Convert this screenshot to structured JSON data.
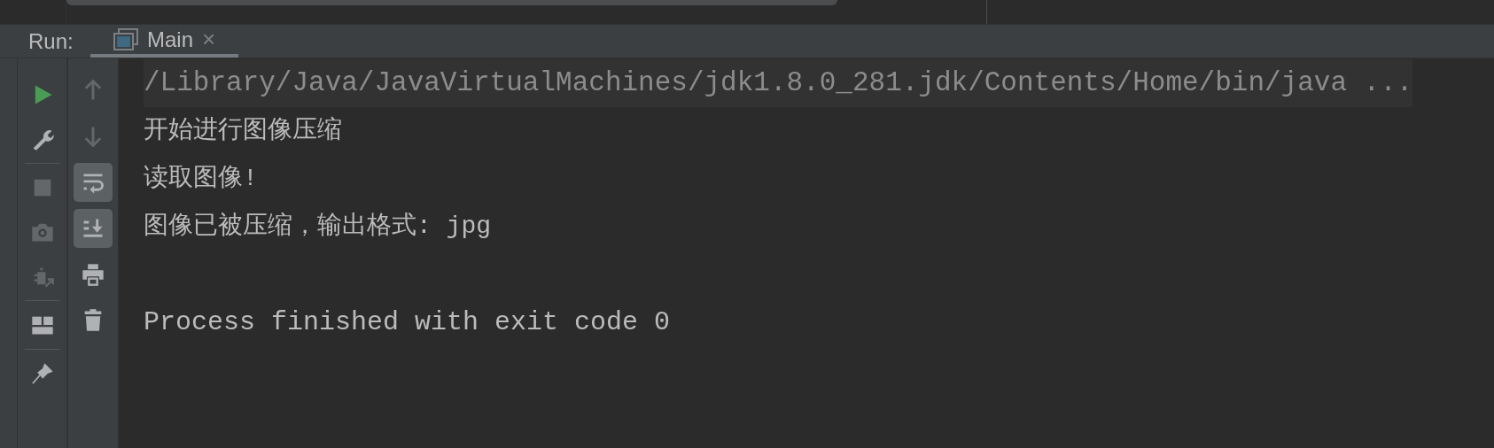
{
  "run_panel": {
    "label": "Run:",
    "tabs": [
      {
        "label": "Main",
        "selected": true,
        "close": "×"
      }
    ]
  },
  "left_toolbar": [
    {
      "disabled": false
    },
    {
      "disabled": false
    },
    {
      "disabled": true
    },
    {
      "disabled": true
    },
    {
      "disabled": true
    },
    {
      "disabled": false
    },
    {
      "disabled": false
    }
  ],
  "console_toolbar": [
    {
      "disabled": true,
      "on": false
    },
    {
      "disabled": true,
      "on": false
    },
    {
      "disabled": false,
      "on": true
    },
    {
      "disabled": false,
      "on": true
    },
    {
      "disabled": false,
      "on": false
    },
    {
      "disabled": false,
      "on": false
    }
  ],
  "console": [
    {
      "kind": "command",
      "text": "/Library/Java/JavaVirtualMachines/jdk1.8.0_281.jdk/Contents/Home/bin/java ..."
    },
    {
      "kind": "output",
      "text": "开始进行图像压缩"
    },
    {
      "kind": "output",
      "text": "读取图像!"
    },
    {
      "kind": "output",
      "text": "图像已被压缩，输出格式: jpg"
    },
    {
      "kind": "exit",
      "text": "Process finished with exit code 0"
    }
  ]
}
